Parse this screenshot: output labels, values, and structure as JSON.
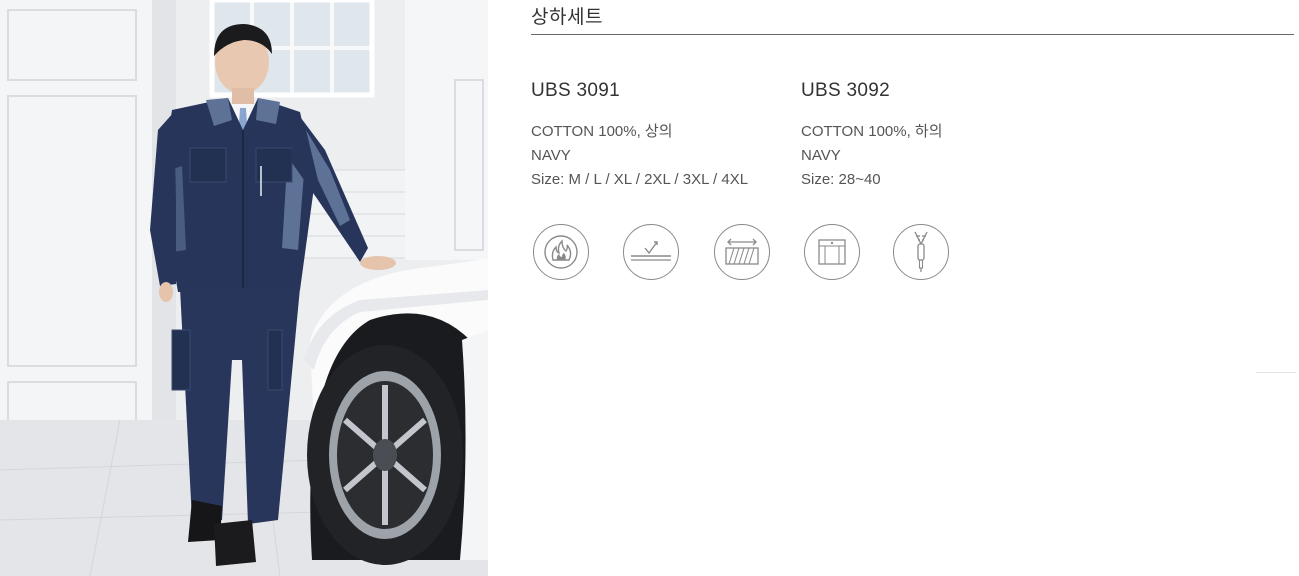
{
  "section": {
    "title": "상하세트"
  },
  "products": [
    {
      "code": "UBS 3091",
      "lines": [
        "COTTON 100%, 상의",
        "NAVY",
        "Size: M / L / XL / 2XL / 3XL / 4XL"
      ]
    },
    {
      "code": "UBS 3092",
      "lines": [
        "COTTON 100%, 하의",
        "NAVY",
        "Size: 28~40"
      ]
    }
  ],
  "feature_icons": [
    "flame-retardant-icon",
    "moisture-wicking-icon",
    "stretch-fabric-icon",
    "pocket-icon",
    "zipper-icon"
  ],
  "colors": {
    "navy": "#27355a",
    "navy_panel": "#5d7296",
    "rule": "#6a6a6a",
    "icon_stroke": "#8a8a8a"
  }
}
